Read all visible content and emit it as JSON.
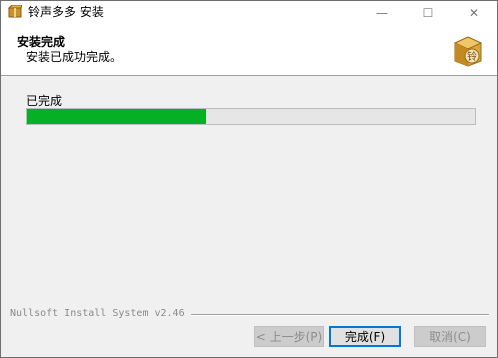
{
  "window": {
    "title": "铃声多多 安装",
    "controls": {
      "minimize": "—",
      "maximize": "☐",
      "close": "✕"
    },
    "icon": "package-icon"
  },
  "header": {
    "title": "安装完成",
    "subtitle": "安装已成功完成。",
    "icon": "package-seal-icon",
    "icon_glyph": "铃"
  },
  "content": {
    "status_label": "已完成",
    "progress": 0.4,
    "progress_color": "#06b025"
  },
  "footer": {
    "branding": "Nullsoft Install System v2.46",
    "buttons": {
      "back": "< 上一步(P)",
      "finish": "完成(F)",
      "cancel": "取消(C)"
    }
  }
}
